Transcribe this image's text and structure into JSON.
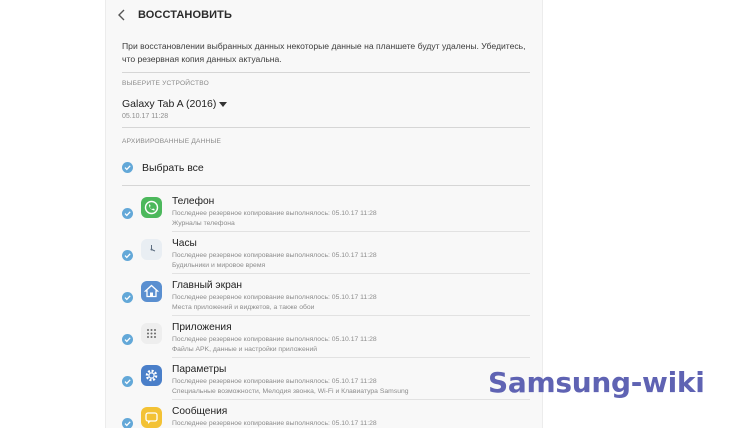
{
  "header": {
    "title": "ВОССТАНОВИТЬ"
  },
  "notice": "При восстановлении выбранных данных некоторые данные на планшете будут удалены. Убедитесь, что резервная копия данных актуальна.",
  "device_section": {
    "label": "ВЫБЕРИТЕ УСТРОЙСТВО",
    "device_name": "Galaxy Tab A (2016)",
    "device_date": "05.10.17 11:28"
  },
  "backup_section": {
    "label": "АРХИВИРОВАННЫЕ ДАННЫЕ",
    "select_all": "Выбрать все"
  },
  "items": [
    {
      "title": "Телефон",
      "last_backup": "Последнее резервное копирование выполнялось: 05.10.17 11:28",
      "description": "Журналы телефона",
      "icon": "phone-icon",
      "icon_color": "#4cb85c"
    },
    {
      "title": "Часы",
      "last_backup": "Последнее резервное копирование выполнялось: 05.10.17 11:28",
      "description": "Будильники и мировое время",
      "icon": "clock-icon",
      "icon_color": "#e9eef3"
    },
    {
      "title": "Главный экран",
      "last_backup": "Последнее резервное копирование выполнялось: 05.10.17 11:28",
      "description": "Места приложений и виджетов, а также обои",
      "icon": "home-icon",
      "icon_color": "#5a8fd0"
    },
    {
      "title": "Приложения",
      "last_backup": "Последнее резервное копирование выполнялось: 05.10.17 11:28",
      "description": "Файлы APK, данные и настройки приложений",
      "icon": "apps-grid-icon",
      "icon_color": "#eeeeee"
    },
    {
      "title": "Параметры",
      "last_backup": "Последнее резервное копирование выполнялось: 05.10.17 11:28",
      "description": "Специальные возможности, Мелодия звонка, Wi-Fi и Клавиатура Samsung",
      "icon": "settings-gear-icon",
      "icon_color": "#4a7fc9"
    },
    {
      "title": "Сообщения",
      "last_backup": "Последнее резервное копирование выполнялось: 05.10.17 11:28",
      "description": "",
      "icon": "messages-icon",
      "icon_color": "#f3c235"
    }
  ],
  "watermark": "Samsung-wiki",
  "colors": {
    "checkbox": "#63a8d8",
    "watermark": "#5f63b3"
  }
}
